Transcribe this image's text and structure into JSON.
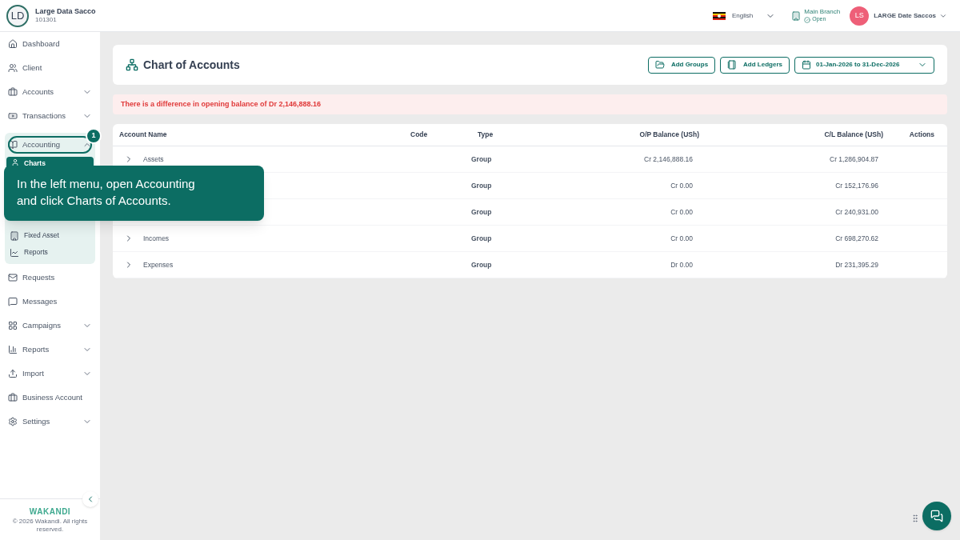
{
  "org": {
    "initials": "LD",
    "name": "Large Data Sacco",
    "code": "101301"
  },
  "header": {
    "language": "English",
    "branch": "Main Branch",
    "branch_status": "Open",
    "user_initials": "LS",
    "user_name": "LARGE Date Saccos"
  },
  "sidebar": {
    "items": [
      {
        "label": "Dashboard",
        "expandable": false
      },
      {
        "label": "Client",
        "expandable": false
      },
      {
        "label": "Accounts",
        "expandable": true
      },
      {
        "label": "Transactions",
        "expandable": true
      },
      {
        "label": "Accounting",
        "expandable": true,
        "expanded": true,
        "highlighted": true,
        "children": [
          {
            "label": "Charts"
          },
          {
            "label": "Fixed Asset"
          },
          {
            "label": "Reports"
          }
        ]
      },
      {
        "label": "Requests",
        "expandable": false
      },
      {
        "label": "Messages",
        "expandable": false
      },
      {
        "label": "Campaigns",
        "expandable": true
      },
      {
        "label": "Reports",
        "expandable": true
      },
      {
        "label": "Import",
        "expandable": true
      },
      {
        "label": "Business Account",
        "expandable": false
      },
      {
        "label": "Settings",
        "expandable": true
      }
    ],
    "brand": "WAKANDI",
    "copyright": "© 2026 Wakandi. All rights reserved."
  },
  "page": {
    "title": "Chart of Accounts",
    "buttons": [
      "Add Groups",
      "Add Ledgers"
    ],
    "date_range": "01-Jan-2026 to 31-Dec-2026"
  },
  "alert": "There is a difference in opening balance of Dr 2,146,888.16",
  "table": {
    "columns": [
      "Account Name",
      "Code",
      "Type",
      "O/P Balance (USh)",
      "C/L Balance (USh)",
      "Actions"
    ],
    "rows": [
      {
        "name": "Assets",
        "type": "Group",
        "op": "Cr 2,146,888.16",
        "cl": "Cr 1,286,904.87"
      },
      {
        "type": "Group",
        "op": "Cr 0.00",
        "cl": "Cr 152,176.96"
      },
      {
        "type": "Group",
        "op": "Cr 0.00",
        "cl": "Cr 240,931.00"
      },
      {
        "name": "Incomes",
        "type": "Group",
        "op": "Cr 0.00",
        "cl": "Cr 698,270.62"
      },
      {
        "name": "Expenses",
        "type": "Group",
        "op": "Dr 0.00",
        "cl": "Dr 231,395.29"
      }
    ]
  },
  "callout": {
    "step": "1",
    "text": "In the left menu, open Accounting and click Charts of Accounts."
  }
}
